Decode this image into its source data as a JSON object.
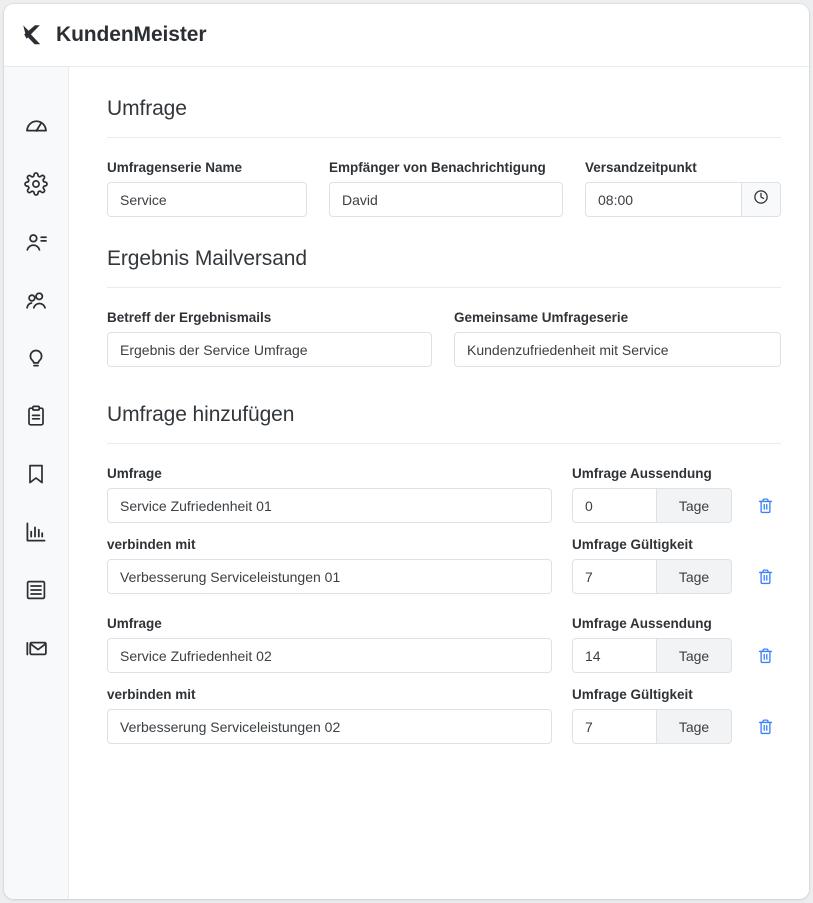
{
  "app": {
    "brand_name": "KundenMeister",
    "logo_icon": "k-logo-icon"
  },
  "sidebar": {
    "items": [
      {
        "icon": "dashboard-gauge-icon",
        "name": "dashboard"
      },
      {
        "icon": "gear-icon",
        "name": "settings"
      },
      {
        "icon": "user-details-icon",
        "name": "contacts"
      },
      {
        "icon": "users-group-icon",
        "name": "groups"
      },
      {
        "icon": "lightbulb-icon",
        "name": "ideas"
      },
      {
        "icon": "clipboard-icon",
        "name": "tasks"
      },
      {
        "icon": "bookmark-icon",
        "name": "bookmarks"
      },
      {
        "icon": "bar-chart-icon",
        "name": "reports"
      },
      {
        "icon": "list-table-icon",
        "name": "lists"
      },
      {
        "icon": "envelope-icon",
        "name": "mail"
      }
    ]
  },
  "sections": {
    "survey": {
      "title": "Umfrage",
      "fields": {
        "series_name": {
          "label": "Umfragenserie Name",
          "value": "Service"
        },
        "recipient": {
          "label": "Empfänger von Benachrichtigung",
          "value": "David"
        },
        "send_time": {
          "label": "Versandzeitpunkt",
          "value": "08:00",
          "addon_icon": "clock-icon"
        }
      }
    },
    "result_mail": {
      "title": "Ergebnis Mailversand",
      "fields": {
        "subject": {
          "label": "Betreff der Ergebnismails",
          "value": "Ergebnis der Service Umfrage"
        },
        "joint_series": {
          "label": "Gemeinsame Umfrageserie",
          "value": "Kundenzufriedenheit mit Service"
        }
      }
    },
    "add_survey": {
      "title": "Umfrage hinzufügen",
      "unit_label": "Tage",
      "delete_icon": "trash-icon",
      "blocks": [
        {
          "survey": {
            "label": "Umfrage",
            "value": "Service Zufriedenheit 01",
            "side_label": "Umfrage Aussendung",
            "side_value": "0"
          },
          "link": {
            "label": "verbinden mit",
            "value": "Verbesserung Serviceleistungen 01",
            "side_label": "Umfrage Gültigkeit",
            "side_value": "7"
          }
        },
        {
          "survey": {
            "label": "Umfrage",
            "value": "Service Zufriedenheit 02",
            "side_label": "Umfrage Aussendung",
            "side_value": "14"
          },
          "link": {
            "label": "verbinden mit",
            "value": "Verbesserung Serviceleistungen 02",
            "side_label": "Umfrage Gültigkeit",
            "side_value": "7"
          }
        }
      ]
    }
  },
  "colors": {
    "accent_blue": "#3b82f6",
    "text_dark": "#2b2f33",
    "border": "#dee2e6",
    "sidebar_bg": "#f8f9fa"
  }
}
